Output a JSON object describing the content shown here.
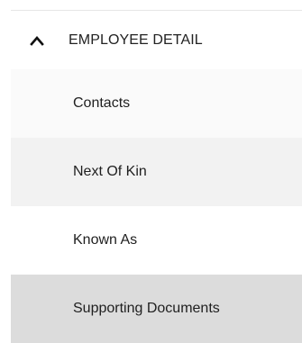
{
  "section": {
    "title": "EMPLOYEE DETAIL",
    "expanded_icon": "chevron-up-icon"
  },
  "items": [
    {
      "label": "Contacts",
      "selected": false
    },
    {
      "label": "Next Of Kin",
      "selected": false
    },
    {
      "label": "Known As",
      "selected": false
    },
    {
      "label": "Supporting Documents",
      "selected": true
    }
  ],
  "colors": {
    "selected_bg": "#dcdcdc",
    "text": "#1f1f1f"
  }
}
